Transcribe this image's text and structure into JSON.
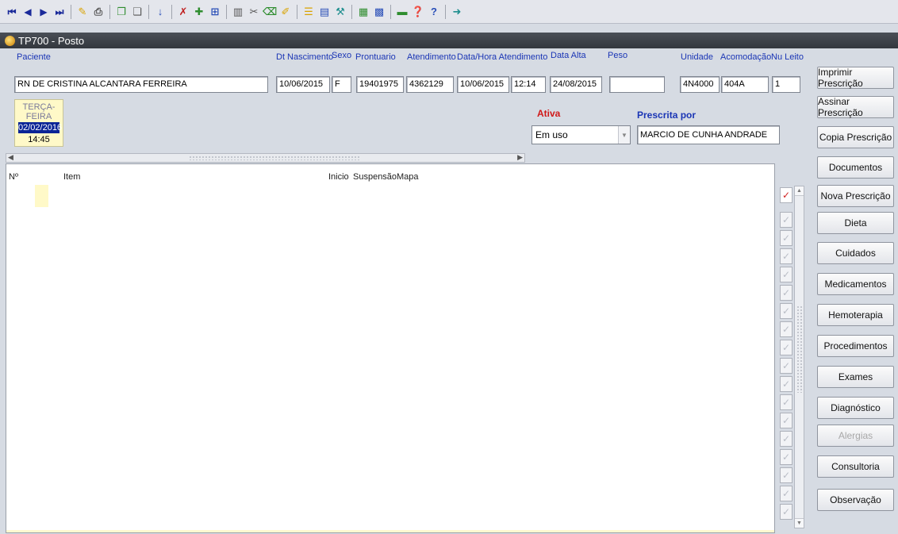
{
  "toolbar": {
    "icons": [
      "first-record-icon",
      "previous-record-icon",
      "next-record-icon",
      "last-record-icon",
      "edit-icon",
      "print-icon",
      "copy-icon",
      "paste-icon",
      "save-icon",
      "delete-icon",
      "insert-icon",
      "duplicate-icon",
      "columns-icon",
      "cut-icon",
      "clear-icon",
      "pen-icon",
      "list-icon",
      "form-icon",
      "tools-icon",
      "grid-icon",
      "grid2-icon",
      "green-bar-icon",
      "help-icon",
      "question-icon",
      "exit-icon"
    ]
  },
  "window": {
    "title": "TP700 - Posto"
  },
  "patient": {
    "paciente_label": "Paciente",
    "paciente": "RN DE CRISTINA ALCANTARA FERREIRA",
    "nascimento_label": "Dt Nascimento",
    "nascimento": "10/06/2015",
    "sexo_label": "Sexo",
    "sexo": "F",
    "prontuario_label": "Prontuario",
    "prontuario": "19401975",
    "atendimento_label": "Atendimento",
    "atendimento": "4362129",
    "datahora_label": "Data/Hora Atendimento",
    "data_atendimento": "10/06/2015",
    "hora_atendimento": "12:14",
    "alta_label": "Data Alta",
    "alta": "24/08/2015",
    "peso_label": "Peso",
    "peso": "",
    "unidade_label": "Unidade",
    "unidade": "4N4000",
    "acomodacao_label": "Acomodação",
    "acomodacao": "404A",
    "leito_label": "Nu Leito",
    "leito": "1"
  },
  "prescription": {
    "weekday": "TERÇA-FEIRA",
    "date": "02/02/2016",
    "time": "14:45",
    "ativa_label": "Ativa",
    "status": "Em uso",
    "prescrita_label": "Prescrita por",
    "prescrita_por": "MARCIO DE CUNHA ANDRADE"
  },
  "grid": {
    "columns": {
      "num": "Nº",
      "item": "Item",
      "inicio": "Inicio",
      "suspensao": "Suspensão",
      "mapa": "Mapa"
    }
  },
  "buttons": {
    "imprimir": "Imprimir Prescrição",
    "assinar": "Assinar Prescrição",
    "copia": "Copia Prescrição",
    "documentos": "Documentos",
    "nova": "Nova Prescrição",
    "dieta": "Dieta",
    "cuidados": "Cuidados",
    "medicamentos": "Medicamentos",
    "hemoterapia": "Hemoterapia",
    "procedimentos": "Procedimentos",
    "exames": "Exames",
    "diagnostico": "Diagnóstico",
    "alergias": "Alergias",
    "consultoria": "Consultoria",
    "observacao": "Observação"
  },
  "colors": {
    "label_blue": "#1a35b5",
    "ativa_red": "#d01818",
    "date_highlight": "#0a2496",
    "titlebar": "#3a3e45"
  }
}
